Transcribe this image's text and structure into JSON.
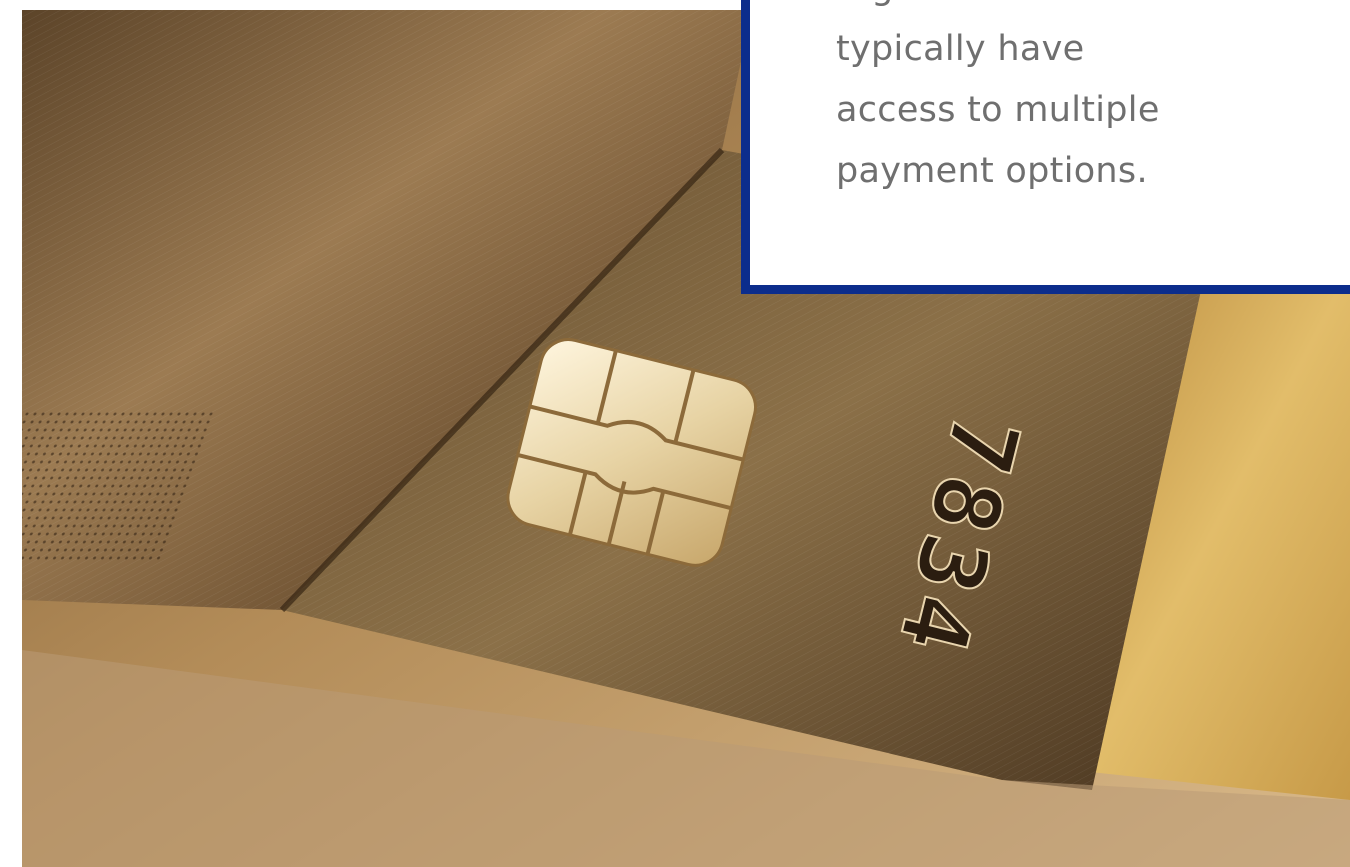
{
  "hero": {
    "image_alt": "Close-up of stacked credit cards with an EMV chip and embossed digits",
    "embossed_digits": "7834",
    "colors": {
      "card_dark": "#3b2a18",
      "card_gold": "#d6ae5c",
      "chip": "#e8d7b0",
      "accent_border": "#0c2d8c"
    }
  },
  "caption": {
    "text": "…g\ntypically have\naccess to multiple\npayment options."
  }
}
